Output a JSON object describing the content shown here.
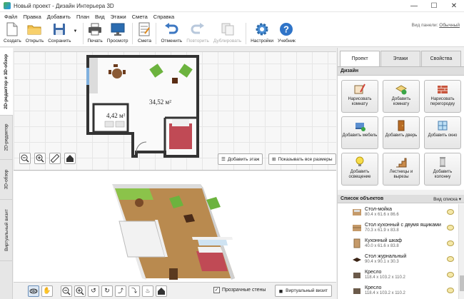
{
  "window": {
    "title": "Новый проект - Дизайн Интерьера 3D",
    "minimize": "—",
    "maximize": "☐",
    "close": "✕"
  },
  "menu": [
    "Файл",
    "Правка",
    "Добавить",
    "План",
    "Вид",
    "Этажи",
    "Смета",
    "Справка"
  ],
  "toolbar": {
    "create": "Создать",
    "open": "Открыть",
    "save": "Сохранить",
    "print": "Печать",
    "preview": "Просмотр",
    "estimate": "Смета",
    "undo": "Отменить",
    "redo": "Повторить",
    "duplicate": "Дублировать",
    "settings": "Настройки",
    "tutorial": "Учебник",
    "panel_view_label": "Вид панели:",
    "panel_view_value": "Обычный"
  },
  "vtabs": [
    "2D-редактор и 3D-обзор",
    "2D-редактор",
    "3D-обзор",
    "Виртуальный визит"
  ],
  "plan": {
    "area_main": "34,52 м²",
    "area_small": "4,42 м²",
    "add_floor": "Добавить этаж",
    "show_sizes": "Показывать все размеры"
  },
  "bottom": {
    "transparent_walls": "Прозрачные стены",
    "virtual_visit": "Виртуальный визит"
  },
  "rpanel": {
    "tabs": [
      "Проект",
      "Этажи",
      "Свойства"
    ],
    "design_title": "Дизайн",
    "buttons": [
      "Нарисовать комнату",
      "Добавить комнату",
      "Нарисовать перегородку",
      "Добавить мебель",
      "Добавить дверь",
      "Добавить окно",
      "Добавить освещение",
      "Лестницы и вырезы",
      "Добавить колонну"
    ],
    "objects_title": "Список объектов",
    "objects_view": "Вид списка",
    "objects": [
      {
        "name": "Стол-мойка",
        "dim": "80.4 x 61.6 x 86.6"
      },
      {
        "name": "Стол кухонный с двумя ящиками",
        "dim": "70.3 x 61.9 x 83.8"
      },
      {
        "name": "Кухонный шкаф",
        "dim": "40.0 x 61.6 x 83.8"
      },
      {
        "name": "Стол журнальный",
        "dim": "90.4 x 90.1 x 30.3"
      },
      {
        "name": "Кресло",
        "dim": "118.4 x 103.2 x 110.2"
      },
      {
        "name": "Кресло",
        "dim": "118.4 x 103.2 x 110.2"
      }
    ]
  }
}
